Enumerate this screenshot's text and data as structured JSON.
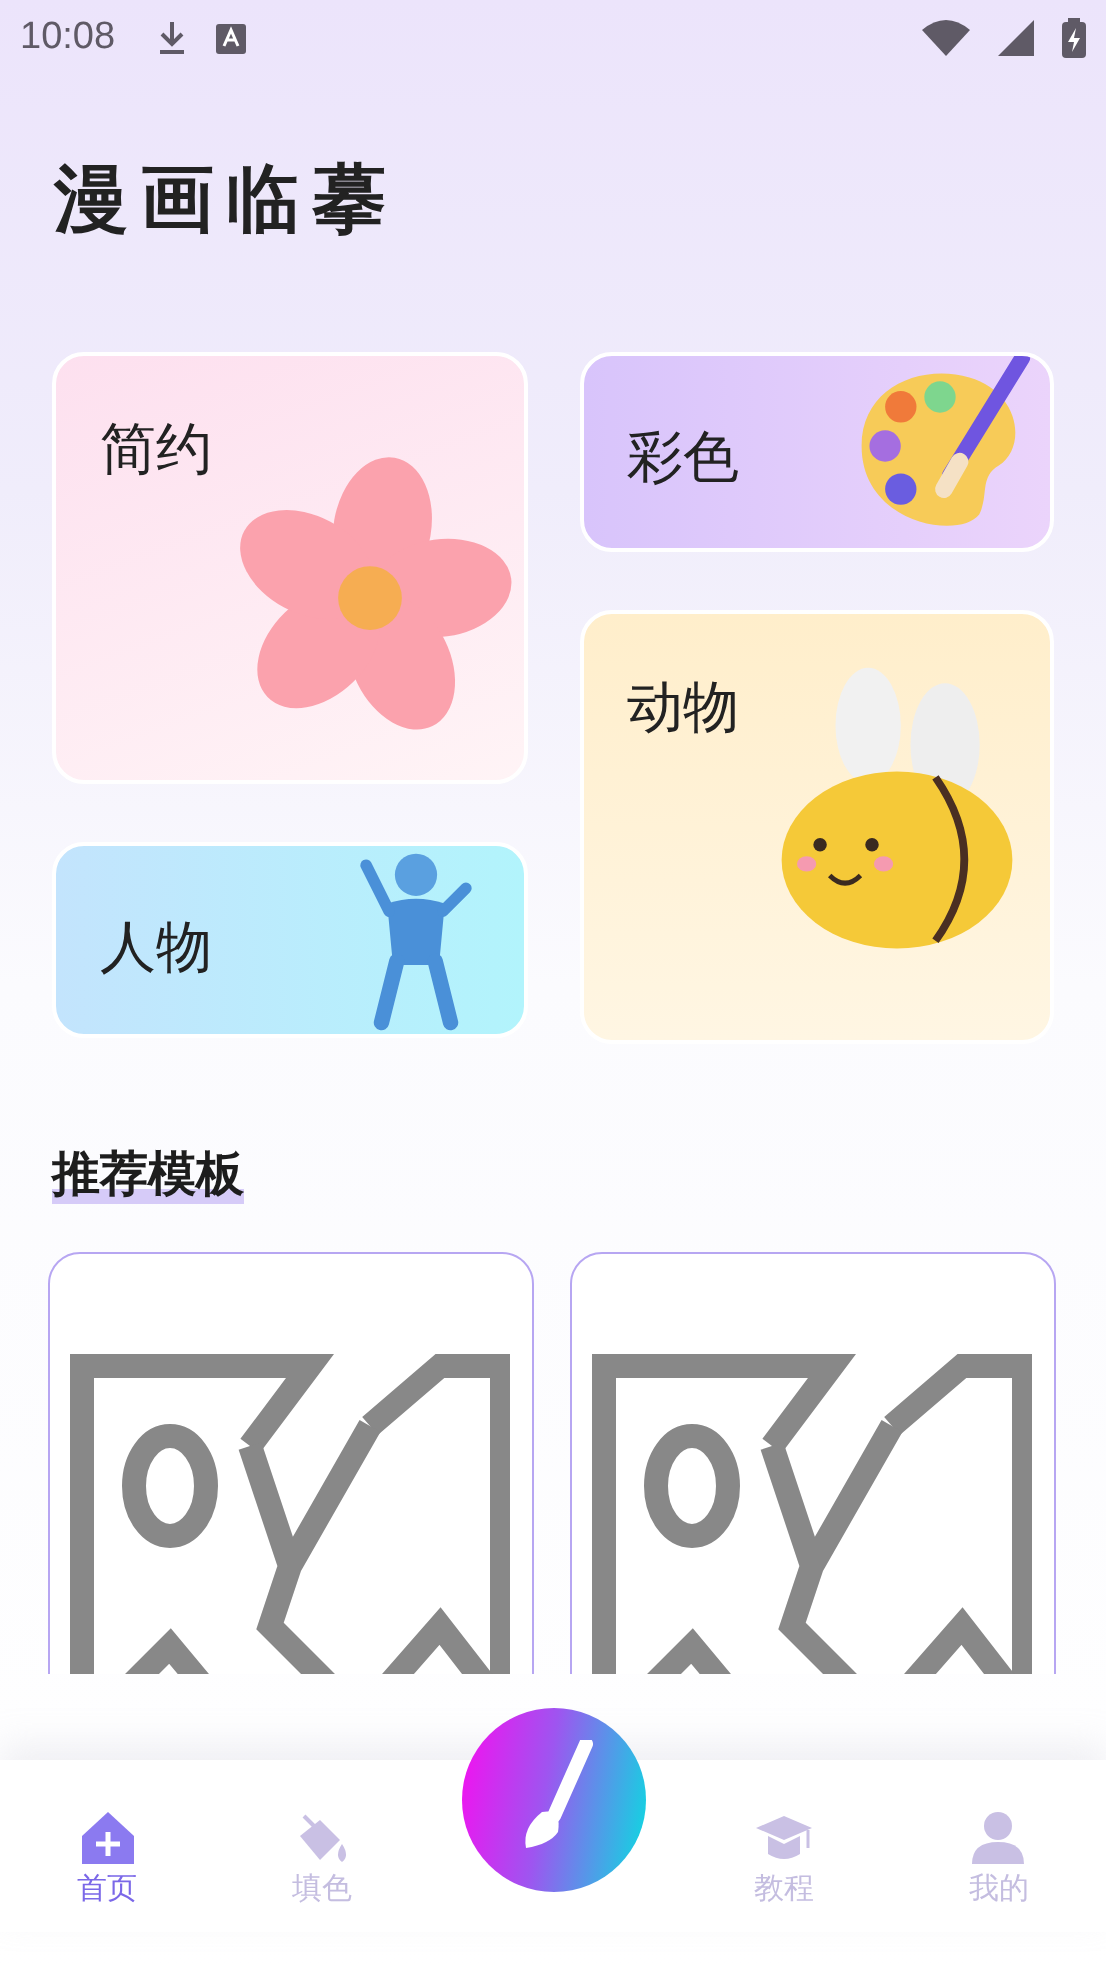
{
  "status_bar": {
    "time": "10:08"
  },
  "title": "漫画临摹",
  "categories": [
    {
      "label": "简约",
      "kind": "flower"
    },
    {
      "label": "人物",
      "kind": "figure"
    },
    {
      "label": "彩色",
      "kind": "palette"
    },
    {
      "label": "动物",
      "kind": "bee"
    }
  ],
  "section_title": "推荐模板",
  "templates": [
    {
      "kind": "broken-image"
    },
    {
      "kind": "broken-image"
    }
  ],
  "nav": [
    {
      "kind": "tab",
      "label": "首页",
      "selected": true
    },
    {
      "kind": "tab",
      "label": "填色",
      "selected": false
    },
    {
      "kind": "center"
    },
    {
      "kind": "tab",
      "label": "教程",
      "selected": false
    },
    {
      "kind": "tab",
      "label": "我的",
      "selected": false
    }
  ]
}
